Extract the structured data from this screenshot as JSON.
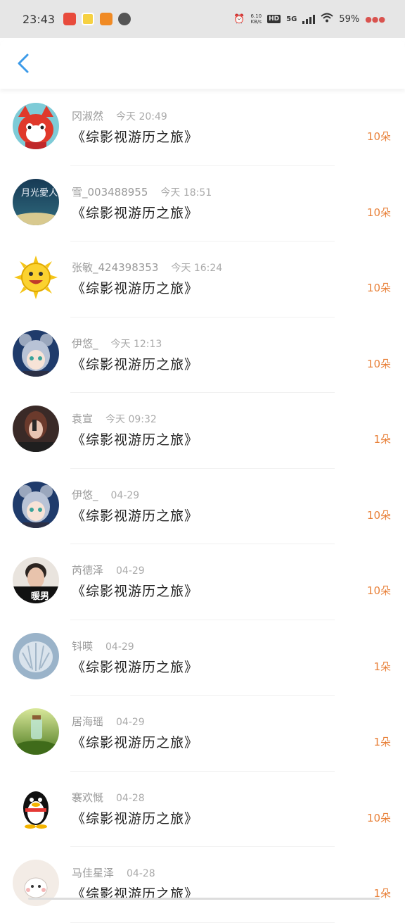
{
  "status_bar": {
    "time": "23:43",
    "net_speed_value": "6.10",
    "net_speed_unit": "KB/s",
    "hd_label": "HD",
    "network": "5G",
    "battery": "59%"
  },
  "header": {
    "back_icon": "chevron-left-icon",
    "accent_color": "#3d9be9"
  },
  "gift_list": [
    {
      "user": "冈淑然",
      "date": "今天 20:49",
      "book": "《综影视游历之旅》",
      "amount": "10朵"
    },
    {
      "user": "雪_003488955",
      "date": "今天 18:51",
      "book": "《综影视游历之旅》",
      "amount": "10朵"
    },
    {
      "user": "张敏_424398353",
      "date": "今天 16:24",
      "book": "《综影视游历之旅》",
      "amount": "10朵"
    },
    {
      "user": "伊悠_",
      "date": "今天 12:13",
      "book": "《综影视游历之旅》",
      "amount": "10朵"
    },
    {
      "user": "袁宣",
      "date": "今天 09:32",
      "book": "《综影视游历之旅》",
      "amount": "1朵"
    },
    {
      "user": "伊悠_",
      "date": "04-29",
      "book": "《综影视游历之旅》",
      "amount": "10朵"
    },
    {
      "user": "芮德泽",
      "date": "04-29",
      "book": "《综影视游历之旅》",
      "amount": "10朵"
    },
    {
      "user": "钭暎",
      "date": "04-29",
      "book": "《综影视游历之旅》",
      "amount": "1朵"
    },
    {
      "user": "居海瑶",
      "date": "04-29",
      "book": "《综影视游历之旅》",
      "amount": "1朵"
    },
    {
      "user": "褰欢慨",
      "date": "04-28",
      "book": "《综影视游历之旅》",
      "amount": "10朵"
    },
    {
      "user": "马佳星泽",
      "date": "04-28",
      "book": "《综影视游历之旅》",
      "amount": "1朵"
    }
  ],
  "avatar_labels": {
    "row2": "月光愛人",
    "row7": "暖男"
  },
  "colors": {
    "amount": "#e8813a",
    "title": "#222222",
    "meta": "#9a9a9a"
  }
}
